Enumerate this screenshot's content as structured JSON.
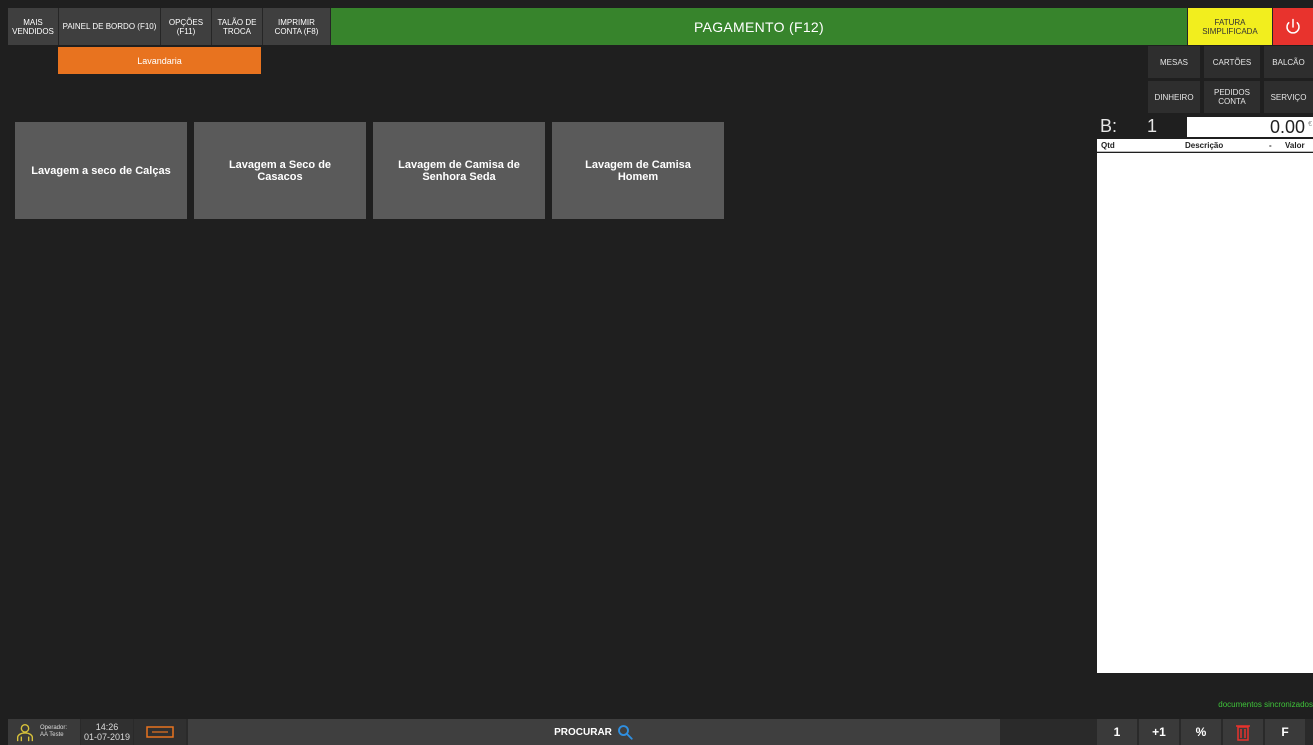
{
  "topbar": {
    "mais_vendidos": "MAIS\nVENDIDOS",
    "painel_bordo": "PAINEL DE BORDO (F10)",
    "opcoes": "OPÇÕES\n(F11)",
    "talao_troca": "TALÃO DE\nTROCA",
    "imprimir_conta": "IMPRIMIR\nCONTA (F8)",
    "pagamento": "PAGAMENTO (F12)",
    "fatura": "FATURA\nSIMPLIFICADA"
  },
  "category": {
    "label": "Lavandaria"
  },
  "right_buttons": {
    "mesas": "MESAS",
    "cartoes": "CARTÕES",
    "balcao": "BALCÃO",
    "dinheiro": "DINHEIRO",
    "pedidos_conta": "PEDIDOS\nCONTA",
    "servico": "SERVIÇO"
  },
  "products": [
    {
      "label": "Lavagem a seco de Calças"
    },
    {
      "label": "Lavagem a Seco de Casacos"
    },
    {
      "label": "Lavagem de Camisa de Senhora Seda"
    },
    {
      "label": "Lavagem de Camisa Homem"
    }
  ],
  "ticket": {
    "label": "B:",
    "number": "1",
    "amount": "0.00",
    "currency": "€",
    "columns": {
      "qty": "Qtd",
      "desc": "Descrição",
      "dash": "-",
      "value": "Valor"
    }
  },
  "sync_status": "documentos sincronizados",
  "bottombar": {
    "operator_label": "Operador:",
    "operator_name": "AA Teste",
    "time": "14:26",
    "date": "01-07-2019",
    "search": "PROCURAR",
    "btn_one": "1",
    "btn_plus_one": "+1",
    "btn_percent": "%",
    "btn_f": "F"
  },
  "colors": {
    "pay_green": "#37842c",
    "fatura_yellow": "#f2ee1e",
    "power_red": "#e8332d",
    "category_orange": "#e8731f",
    "sync_green": "#3fc43a"
  }
}
